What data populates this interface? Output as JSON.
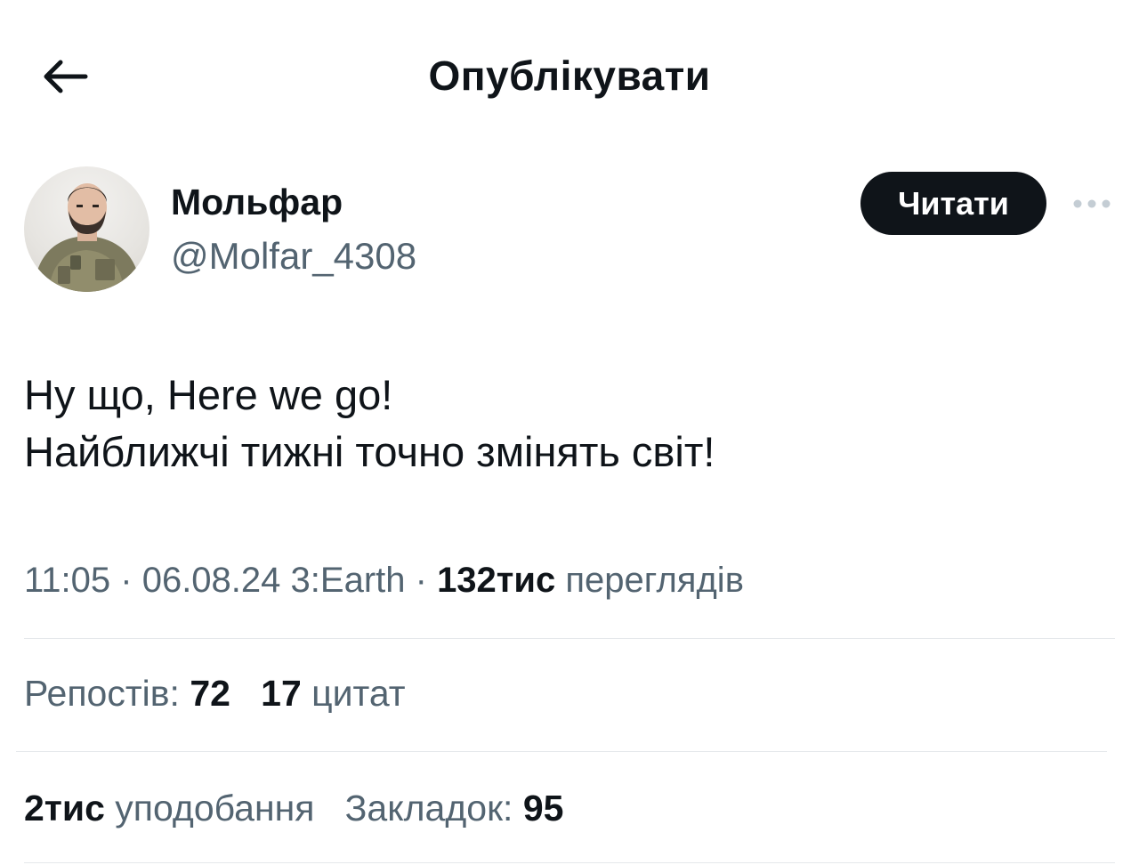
{
  "header": {
    "title": "Опублікувати",
    "back_icon": "arrow-left-icon"
  },
  "author": {
    "name": "Мольфар",
    "handle": "@Molfar_4308",
    "follow_label": "Читати",
    "more_icon": "more-horizontal-icon"
  },
  "tweet": {
    "lines": [
      "Ну що, Here we go!",
      "Найближчі тижні точно змінять світ!"
    ]
  },
  "meta": {
    "time": "11:05",
    "date": "06.08.24",
    "source": "3:Earth",
    "views_count": "132тис",
    "views_label": "переглядів"
  },
  "stats": {
    "reposts_label": "Репостів:",
    "reposts_count": "72",
    "quotes_count": "17",
    "quotes_label": "цитат",
    "likes_count": "2тис",
    "likes_label": "уподобання",
    "bookmarks_label": "Закладок:",
    "bookmarks_count": "95"
  },
  "colors": {
    "text_primary": "#0f1419",
    "text_secondary": "#536471",
    "divider": "#e5e8eb",
    "button_bg": "#0f1419"
  }
}
